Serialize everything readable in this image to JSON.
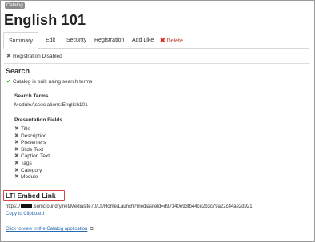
{
  "header": {
    "badge": "Catalog",
    "title": "English 101"
  },
  "tabs": [
    {
      "label": "Summary",
      "active": true
    },
    {
      "label": "Edit"
    },
    {
      "label": "Security"
    },
    {
      "label": "Registration"
    },
    {
      "label": "Add Like"
    },
    {
      "label": "Delete",
      "icon": "close-icon"
    }
  ],
  "registration_status": "Registration Disabled",
  "search": {
    "heading": "Search",
    "status": "Catalog is built using search terms",
    "terms_heading": "Search Terms",
    "terms_value": "ModuleAssociations:English101",
    "fields_heading": "Presentation Fields",
    "fields": [
      "Title",
      "Description",
      "Presenters",
      "Slide Text",
      "Caption Text",
      "Tags",
      "Category",
      "Module"
    ]
  },
  "lti": {
    "heading": "LTI Embed Link",
    "url_prefix": "https://",
    "url_suffix": ".sonicfoundry.net/Mediasite70/Lti/Home/Launch?mediasiteId=d97340e93fb44ce2b3c79a22c44ae2d921",
    "copy_label": "Copy to Clipboard"
  },
  "catalog_link": "Click to view in the Catalog application",
  "colors": {
    "accent_link": "#2a6ab5",
    "danger": "#d9332b",
    "highlight_border": "#d84545"
  }
}
